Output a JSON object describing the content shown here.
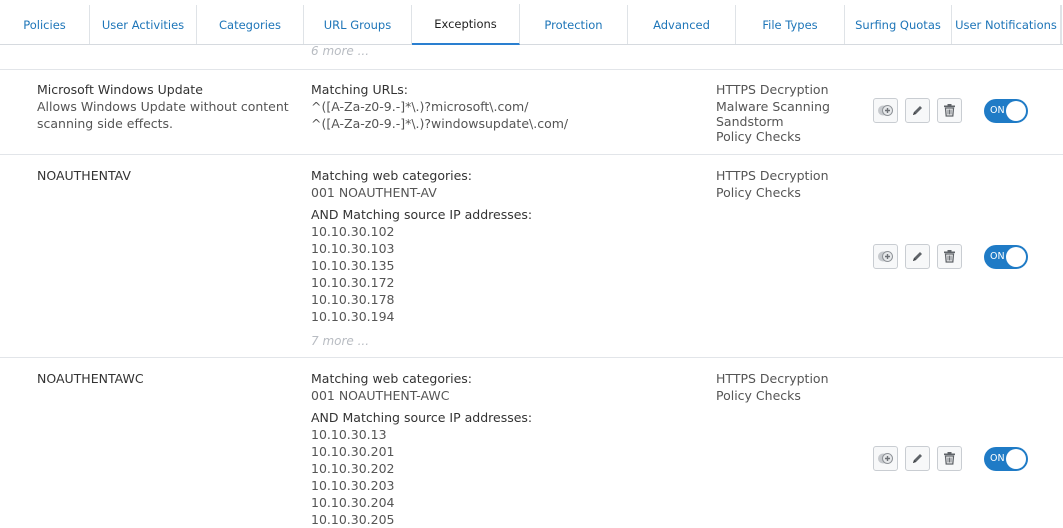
{
  "tabs": [
    {
      "label": "Policies"
    },
    {
      "label": "User Activities"
    },
    {
      "label": "Categories"
    },
    {
      "label": "URL Groups"
    },
    {
      "label": "Exceptions"
    },
    {
      "label": "Protection"
    },
    {
      "label": "Advanced"
    },
    {
      "label": "File Types"
    },
    {
      "label": "Surfing Quotas"
    },
    {
      "label": "User Notifications"
    }
  ],
  "top_more": "6 more ...",
  "exceptions": [
    {
      "name": "Microsoft Windows Update",
      "description": "Allows Windows Update without content scanning side effects.",
      "criteria_title": "Matching URLs:",
      "criteria": [
        "^([A-Za-z0-9.-]*\\.)?microsoft\\.com/",
        "^([A-Za-z0-9.-]*\\.)?windowsupdate\\.com/"
      ],
      "skipped": [
        "HTTPS Decryption",
        "Malware Scanning",
        "Sandstorm",
        "Policy Checks"
      ],
      "toggle": "ON"
    },
    {
      "name": "NOAUTHENTAV",
      "criteria_title": "Matching web categories:",
      "criteria": [
        "001 NOAUTHENT-AV"
      ],
      "ip_title": "AND Matching source IP addresses:",
      "ips": [
        "10.10.30.102",
        "10.10.30.103",
        "10.10.30.135",
        "10.10.30.172",
        "10.10.30.178",
        "10.10.30.194"
      ],
      "more": "7 more ...",
      "skipped": [
        "HTTPS Decryption",
        "Policy Checks"
      ],
      "toggle": "ON"
    },
    {
      "name": "NOAUTHENTAWC",
      "criteria_title": "Matching web categories:",
      "criteria": [
        "001 NOAUTHENT-AWC"
      ],
      "ip_title": "AND Matching source IP addresses:",
      "ips": [
        "10.10.30.13",
        "10.10.30.201",
        "10.10.30.202",
        "10.10.30.203",
        "10.10.30.204",
        "10.10.30.205"
      ],
      "skipped": [
        "HTTPS Decryption",
        "Policy Checks"
      ],
      "toggle": "ON"
    }
  ],
  "actions": {
    "clone_icon": "clone-icon",
    "edit_icon": "pencil-icon",
    "delete_icon": "trash-icon"
  }
}
